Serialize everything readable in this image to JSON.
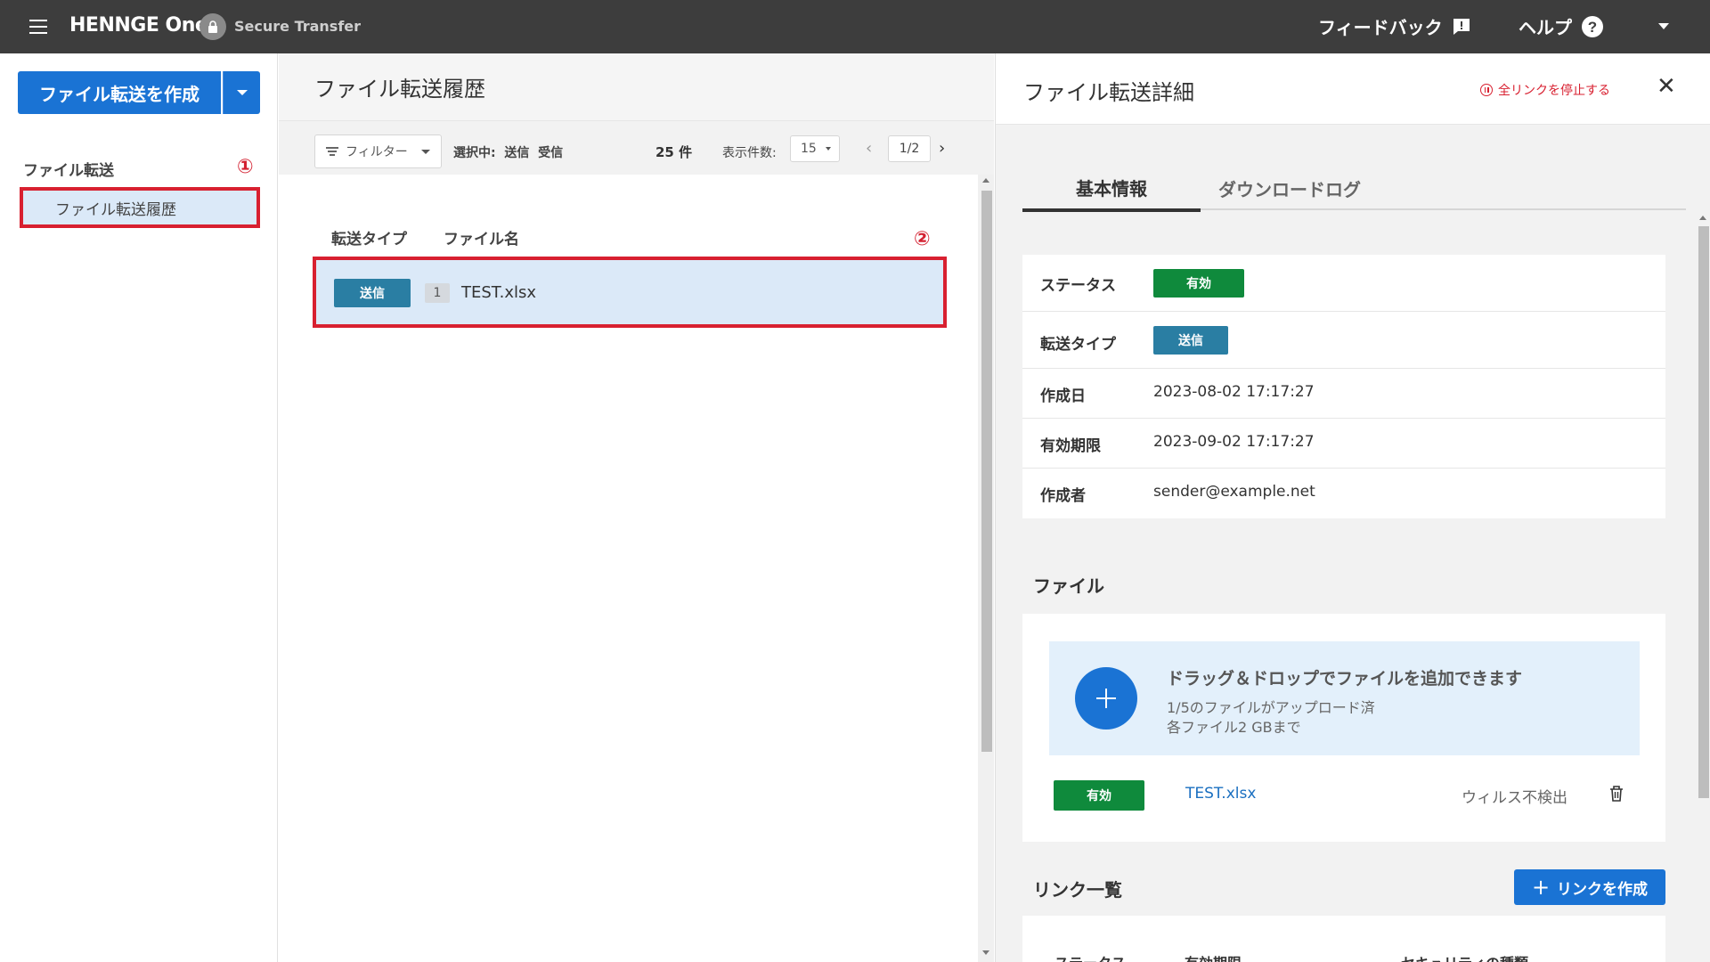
{
  "header": {
    "brand": "HENNGE One",
    "product": "Secure Transfer",
    "feedback_label": "フィードバック",
    "help_label": "ヘルプ"
  },
  "sidebar": {
    "create_button": "ファイル転送を作成",
    "section_label": "ファイル転送",
    "items": [
      {
        "label": "ファイル転送履歴",
        "active": true
      }
    ],
    "marker": "①"
  },
  "list": {
    "title": "ファイル転送履歴",
    "filter_label": "フィルター",
    "selected_label": "選択中:  送信  受信",
    "count_label": "25 件",
    "per_page_label": "表示件数:",
    "per_page_value": "15",
    "page_indicator": "1/2",
    "columns": [
      "転送タイプ",
      "ファイル名"
    ],
    "marker": "②",
    "rows": [
      {
        "type": "送信",
        "file_count": "1",
        "filename": "TEST.xlsx",
        "selected": true
      }
    ]
  },
  "detail": {
    "title": "ファイル転送詳細",
    "stop_all_links": "全リンクを停止する",
    "tabs": [
      "基本情報",
      "ダウンロードログ"
    ],
    "info": {
      "status_label": "ステータス",
      "status_value": "有効",
      "type_label": "転送タイプ",
      "type_value": "送信",
      "created_label": "作成日",
      "created_value": "2023-08-02 17:17:27",
      "expires_label": "有効期限",
      "expires_value": "2023-09-02 17:17:27",
      "author_label": "作成者",
      "author_value": "sender@example.net"
    },
    "files_section": {
      "title": "ファイル",
      "dropzone_title": "ドラッグ＆ドロップでファイルを追加できます",
      "dropzone_sub1": "1/5のファイルがアップロード済",
      "dropzone_sub2": "各ファイル2 GBまで",
      "files": [
        {
          "status": "有効",
          "name": "TEST.xlsx",
          "scan": "ウィルス不検出"
        }
      ]
    },
    "links_section": {
      "title": "リンク一覧",
      "create_button": "リンクを作成",
      "columns": [
        "ステータス",
        "有効期限",
        "セキュリティの種類"
      ]
    }
  },
  "colors": {
    "topbar": "#3d3d3d",
    "primary": "#1a73d4",
    "send_badge": "#2a7ea3",
    "valid_badge": "#0f8a3c",
    "highlight_border": "#d82030",
    "selected_bg": "#dbe9f8"
  }
}
